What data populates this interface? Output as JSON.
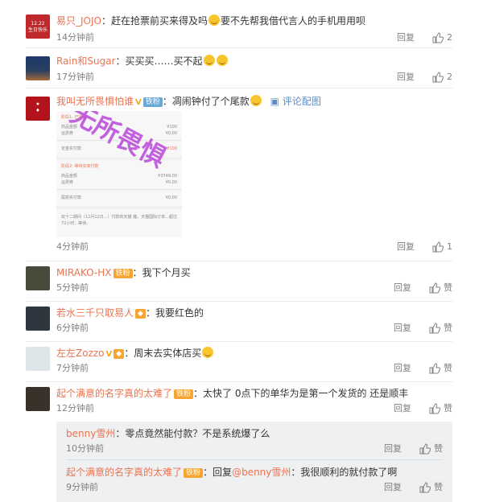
{
  "comments": [
    {
      "name": "易只_JOJO",
      "text": "赶在抢票前买来得及吗",
      "text2": "要不先帮我借代言人的手机用用呗",
      "time": "14分钟前",
      "reply": "回复",
      "likes": "2"
    },
    {
      "name": "Rain和Sugar",
      "text": "买买买……买不起",
      "time": "17分钟前",
      "reply": "回复",
      "likes": "2"
    },
    {
      "name": "我叫无所畏惧怕谁",
      "badge": "铁粉",
      "text": "凋闹钟付了个尾款",
      "link": "评论配图",
      "time": "4分钟前",
      "reply": "回复",
      "likes": "1"
    },
    {
      "name": "MIRAKO-HX",
      "badge": "铁粉",
      "text": "我下个月买",
      "time": "5分钟前",
      "reply": "回复",
      "likes": "赞"
    },
    {
      "name": "若水三千只取易人",
      "text": "我要红色的",
      "time": "6分钟前",
      "reply": "回复",
      "likes": "赞"
    },
    {
      "name": "左左Zozzo",
      "text": "周末去实体店买",
      "time": "7分钟前",
      "reply": "回复",
      "likes": "赞"
    },
    {
      "name": "起个满意的名字真的太难了",
      "badge": "铁粉",
      "text": "太快了 0点下的单华为是第一个发货的 还是顺丰",
      "time": "12分钟前",
      "reply": "回复",
      "likes": "赞"
    }
  ],
  "subreplies": [
    {
      "name": "benny雪州",
      "text": "零点竟然能付款？不是系统爆了么",
      "time": "10分钟前",
      "reply": "回复",
      "likes": "赞"
    },
    {
      "name": "起个满意的名字真的太难了",
      "badge": "铁粉",
      "text_prefix": "回复",
      "mention": "@benny雪州",
      "text": "我很顺利的就付款了啊",
      "time": "9分钟前",
      "reply": "回复",
      "likes": "赞"
    }
  ],
  "review_image": {
    "row1_title": "阶段1: 已完成",
    "row1_a": "商品金额",
    "row1_a_v": "¥100",
    "row1_b": "运费券",
    "row1_b_v": "¥0.00",
    "row1_total": "定金实付款",
    "row1_total_v": "¥100",
    "row2_title": "阶段2: 等待买家付款",
    "row2_a": "商品金额",
    "row2_a_v": "¥3749.00",
    "row2_b": "运费券",
    "row2_b_v": "¥0.00",
    "row2_total": "尾款实付款",
    "row2_total_v": "¥0.00",
    "note": "双十二期间（12月12日...）付款的天猫 魔，天猫国际订单...超过72小时...等待。",
    "watermark": "无所畏惧",
    "avatar_label_1": "12.22",
    "avatar_label_2": "生日快乐"
  },
  "colors": {
    "name": "#eb7350",
    "muted": "#808080",
    "sub_bg": "#eef0f2"
  }
}
